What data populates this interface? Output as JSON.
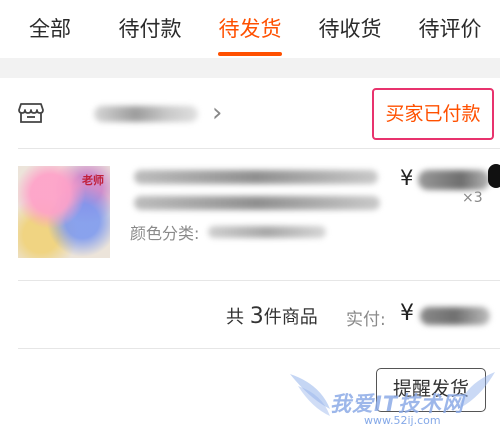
{
  "tabs": [
    {
      "label": "全部",
      "active": false
    },
    {
      "label": "待付款",
      "active": false
    },
    {
      "label": "待发货",
      "active": true
    },
    {
      "label": "待收货",
      "active": false
    },
    {
      "label": "待评价",
      "active": false
    }
  ],
  "order": {
    "shop_icon": "store-icon",
    "chevron_icon": "chevron-right-icon",
    "status": "买家已付款",
    "product": {
      "image_tag": "老师",
      "spec_label": "颜色分类:",
      "price_symbol": "¥",
      "quantity": "×3"
    },
    "summary": {
      "total_prefix": "共",
      "total_count": "3",
      "total_suffix": "件商品",
      "paid_label": "实付:",
      "paid_symbol": "¥"
    },
    "remind_button": "提醒发货"
  },
  "watermark": {
    "text": "我爱IT技术网",
    "url": "www.52ij.com"
  },
  "colors": {
    "accent": "#ff5000",
    "status_border": "#e8336d"
  }
}
